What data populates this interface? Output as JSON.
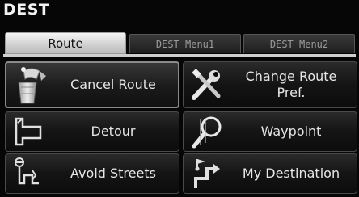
{
  "screen": {
    "title": "DEST"
  },
  "tabs": [
    {
      "label": "Route",
      "active": true
    },
    {
      "label": "DEST Menu1",
      "active": false
    },
    {
      "label": "DEST Menu2",
      "active": false
    }
  ],
  "buttons": {
    "cancel_route": {
      "label": "Cancel Route",
      "icon": "trash-flag-icon"
    },
    "change_route_pref": {
      "line1": "Change Route",
      "line2": "Pref.",
      "icon": "tools-icon"
    },
    "detour": {
      "label": "Detour",
      "icon": "detour-arrow-icon"
    },
    "waypoint": {
      "label": "Waypoint",
      "icon": "magnifier-icon"
    },
    "avoid_streets": {
      "label": "Avoid Streets",
      "icon": "avoid-streets-icon"
    },
    "my_destination": {
      "label": "My Destination",
      "icon": "destination-route-icon"
    }
  }
}
